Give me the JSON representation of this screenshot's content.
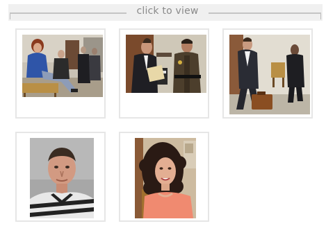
{
  "header": {
    "title": "click to view"
  },
  "gallery": {
    "thumbnails": [
      {
        "subject": "woman-seated-on-courthouse-bench"
      },
      {
        "subject": "two-men-talking-in-courthouse-hallway"
      },
      {
        "subject": "man-with-briefcase-walking-past-deputy"
      },
      {
        "subject": "mugshot-man-striped-jail-uniform"
      },
      {
        "subject": "portrait-woman-with-curly-hair"
      }
    ]
  },
  "colors": {
    "header_bg": "#f0f0f0",
    "header_text": "#8a8a8a",
    "thumb_border": "#e6e6e6"
  }
}
